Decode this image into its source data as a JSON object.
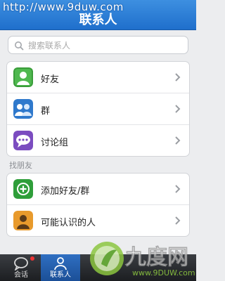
{
  "header": {
    "watermark": "http://www.9duw.com",
    "title": "联系人"
  },
  "search": {
    "placeholder": "搜索联系人"
  },
  "contacts": [
    {
      "label": "好友",
      "icon": "friends-icon"
    },
    {
      "label": "群",
      "icon": "group-icon"
    },
    {
      "label": "讨论组",
      "icon": "discussion-icon"
    }
  ],
  "find": {
    "section_label": "找朋友",
    "items": [
      {
        "label": "添加好友/群",
        "icon": "add-icon"
      },
      {
        "label": "可能认识的人",
        "icon": "person-icon"
      }
    ]
  },
  "tabs": [
    {
      "label": "会话",
      "icon": "chat-icon"
    },
    {
      "label": "联系人",
      "icon": "contacts-icon"
    }
  ],
  "watermark_logo": {
    "text": "九度网",
    "url": "www.9DUW.com"
  },
  "colors": {
    "header_blue": "#2a7fd8",
    "friend_green": "#3a9d3a",
    "group_blue": "#2f79cc",
    "discussion_purple": "#7b4cc0",
    "add_green": "#2f9e3a",
    "person_orange": "#e89a2c"
  }
}
